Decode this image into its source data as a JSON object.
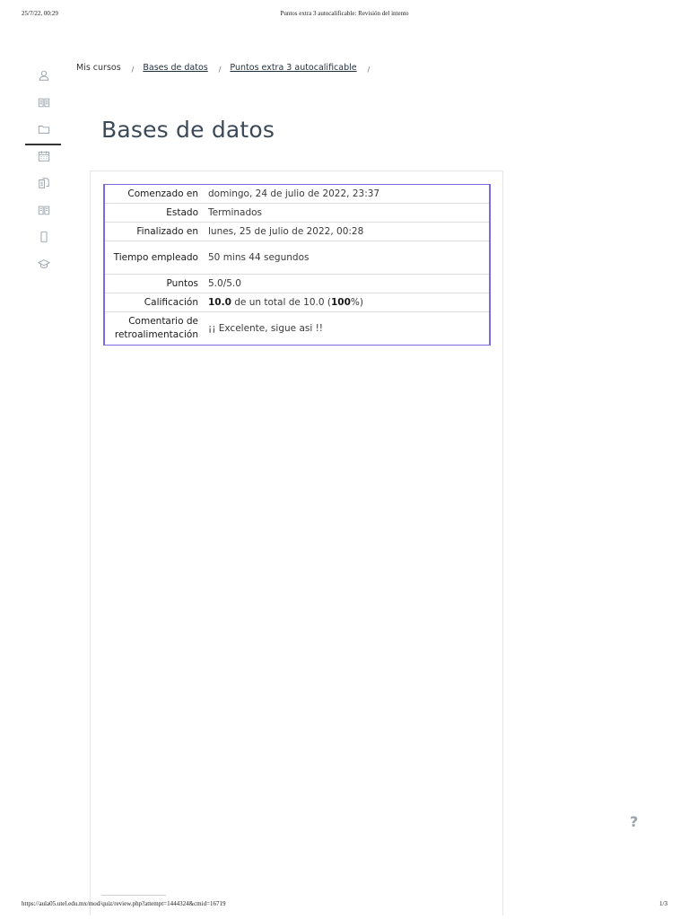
{
  "print_header": {
    "datetime": "25/7/22, 00:29",
    "doc_title": "Puntos extra 3 autocalificable: Revisión del intento"
  },
  "print_footer": {
    "url": "https://aula05.utel.edu.mx/mod/quiz/review.php?attempt=1444324&cmid=16719",
    "page": "1/3"
  },
  "sidebar": {
    "items": [
      {
        "icon": "user-icon"
      },
      {
        "icon": "book-icon"
      },
      {
        "icon": "folder-icon",
        "active": true
      },
      {
        "icon": "calendar-icon"
      },
      {
        "icon": "documents-icon"
      },
      {
        "icon": "open-book-icon"
      },
      {
        "icon": "mobile-icon"
      },
      {
        "icon": "graduation-cap-icon"
      }
    ]
  },
  "breadcrumb": {
    "items": [
      "Mis cursos",
      "Bases de datos",
      "Puntos extra 3 autocalificable"
    ],
    "separator": "/"
  },
  "page": {
    "title": "Bases de datos"
  },
  "summary": {
    "rows": [
      {
        "label": "Comenzado en",
        "value": "domingo, 24 de julio de 2022, 23:37"
      },
      {
        "label": "Estado",
        "value": "Terminados"
      },
      {
        "label": "Finalizado en",
        "value": "lunes, 25 de julio de 2022, 00:28"
      },
      {
        "label": "Tiempo empleado",
        "value": "50 mins 44 segundos"
      },
      {
        "label": "Puntos",
        "value": "5.0/5.0"
      },
      {
        "label": "Calificación",
        "value_grade": "10.0",
        "value_mid": " de un total de 10.0 (",
        "value_pct": "100",
        "value_end": "%)"
      },
      {
        "label": "Comentario de retroalimentación",
        "value": "¡¡ Excelente, sigue asi !!"
      }
    ]
  },
  "help": {
    "label": "?"
  },
  "colors": {
    "table_accent": "#7a69e0",
    "title": "#3c4a58",
    "icon_gray": "#9aa3ad"
  }
}
